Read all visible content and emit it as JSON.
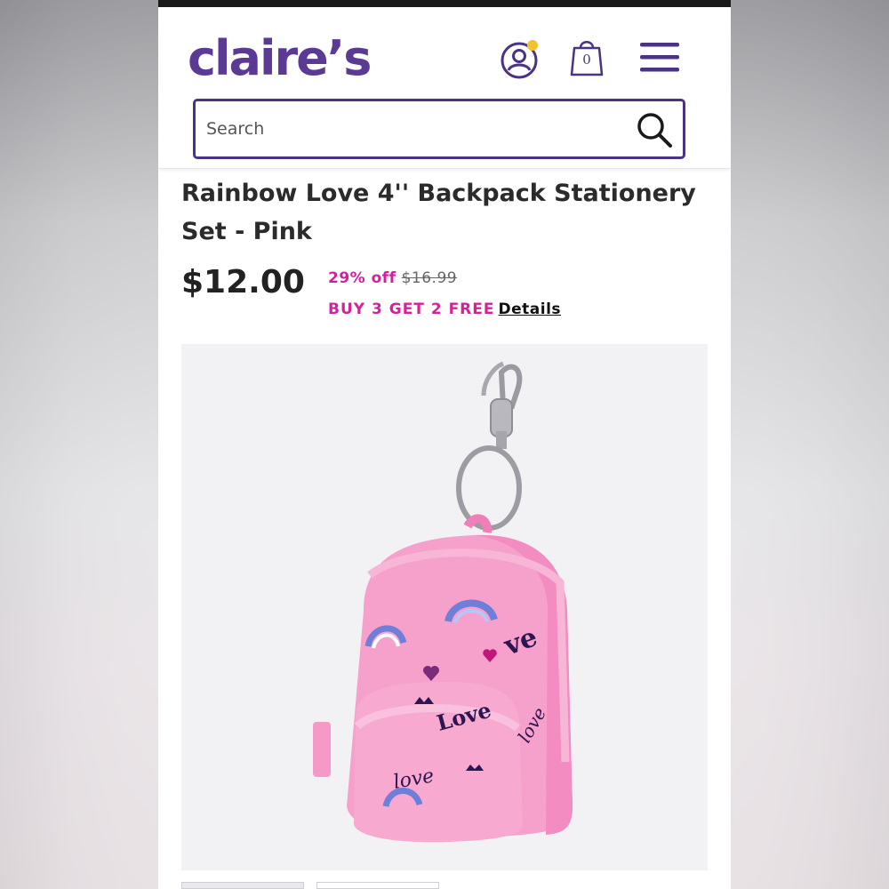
{
  "header": {
    "logo_text": "claire’s",
    "cart_count": "0",
    "search": {
      "placeholder": "Search"
    },
    "colors": {
      "brand": "#5b3a96",
      "notification_dot": "#f2c12e"
    }
  },
  "product": {
    "title": "Rainbow Love 4'' Backpack Stationery Set - Pink",
    "price": "$12.00",
    "discount": "29% off",
    "original_price": "$16.99",
    "promo_offer": "BUY 3 GET 2 FREE",
    "promo_details_link": "Details",
    "colors": {
      "promo": "#d4209a"
    }
  },
  "icons": {
    "account": "account-icon",
    "bag": "shopping-bag-icon",
    "menu": "hamburger-menu-icon",
    "search": "search-icon"
  }
}
